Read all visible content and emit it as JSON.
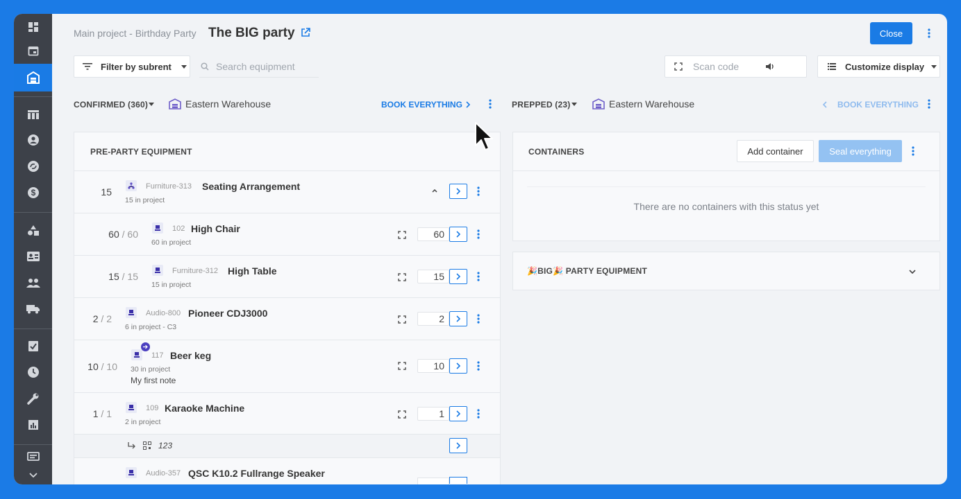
{
  "header": {
    "breadcrumb": "Main project - Birthday Party",
    "title": "The BIG party",
    "close_label": "Close"
  },
  "toolbar": {
    "filter_label": "Filter by subrent",
    "search_placeholder": "Search equipment",
    "scan_placeholder": "Scan code",
    "customize_label": "Customize display"
  },
  "left_column": {
    "status_label": "CONFIRMED (360)",
    "warehouse": "Eastern Warehouse",
    "book_label": "BOOK EVERYTHING",
    "panel_title": "PRE-PARTY EQUIPMENT",
    "group": {
      "qty": "15",
      "code": "Furniture-313",
      "name": "Seating Arrangement",
      "sub": "15 in project"
    },
    "items": [
      {
        "qty": "60",
        "total": "60",
        "code": "102",
        "name": "High Chair",
        "sub": "60 in project",
        "input": "60",
        "note": ""
      },
      {
        "qty": "15",
        "total": "15",
        "code": "Furniture-312",
        "name": "High Table",
        "sub": "15 in project",
        "input": "15",
        "note": ""
      },
      {
        "qty": "2",
        "total": "2",
        "code": "Audio-800",
        "name": "Pioneer CDJ3000",
        "sub": "6 in project - C3",
        "input": "2",
        "note": ""
      },
      {
        "qty": "10",
        "total": "10",
        "code": "117",
        "name": "Beer keg",
        "sub": "30 in project",
        "input": "10",
        "note": "My first note"
      },
      {
        "qty": "1",
        "total": "1",
        "code": "109",
        "name": "Karaoke Machine",
        "sub": "2 in project",
        "input": "1",
        "note": ""
      }
    ],
    "serial": {
      "value": "123"
    },
    "partial_item": {
      "code": "Audio-357",
      "name": "QSC K10.2 Fullrange Speaker"
    }
  },
  "right_column": {
    "status_label": "PREPPED (23)",
    "warehouse": "Eastern Warehouse",
    "book_label": "BOOK EVERYTHING",
    "containers_title": "CONTAINERS",
    "add_container_label": "Add container",
    "seal_label": "Seal everything",
    "empty_message": "There are no containers with this status yet",
    "group_title": "🎉BIG🎉 PARTY EQUIPMENT"
  },
  "colors": {
    "accent": "#1a7be5",
    "rail": "#3d4149",
    "background": "#1b7be6"
  }
}
